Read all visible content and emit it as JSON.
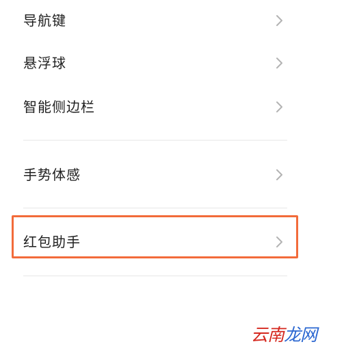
{
  "menu": {
    "items": [
      {
        "label": "导航键"
      },
      {
        "label": "悬浮球"
      },
      {
        "label": "智能侧边栏"
      },
      {
        "label": "手势体感"
      },
      {
        "label": "红包助手"
      }
    ]
  },
  "highlight": {
    "color": "#f26b3a"
  },
  "watermark": {
    "part1": "云南",
    "part2": "龙网",
    "color1": "#d5281f",
    "color2": "#2b67d1"
  }
}
